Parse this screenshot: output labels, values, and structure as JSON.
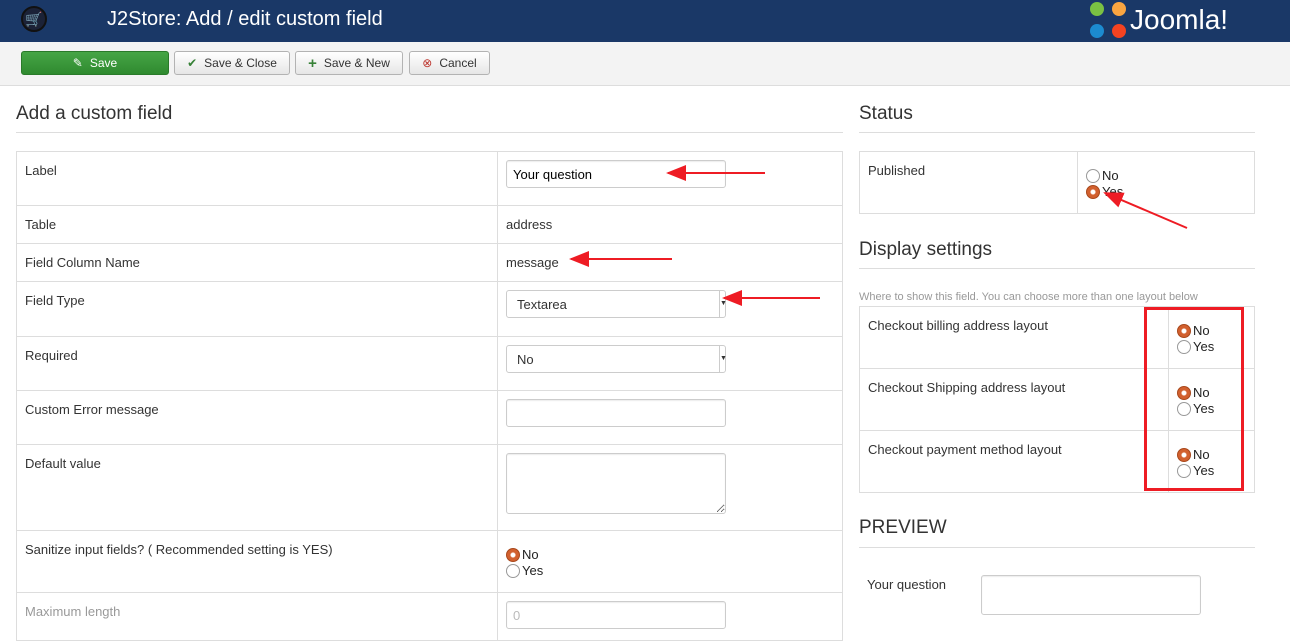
{
  "header": {
    "title": "J2Store: Add / edit custom field",
    "brand": "Joomla!"
  },
  "toolbar": {
    "save": "Save",
    "save_close": "Save & Close",
    "save_new": "Save & New",
    "cancel": "Cancel"
  },
  "main": {
    "heading": "Add a custom field",
    "rows": {
      "label": {
        "label": "Label",
        "value": "Your question"
      },
      "table": {
        "label": "Table",
        "value": "address"
      },
      "column": {
        "label": "Field Column Name",
        "value": "message"
      },
      "type": {
        "label": "Field Type",
        "value": "Textarea"
      },
      "required": {
        "label": "Required",
        "value": "No"
      },
      "error": {
        "label": "Custom Error message",
        "value": ""
      },
      "default": {
        "label": "Default value",
        "value": ""
      },
      "sanitize": {
        "label": "Sanitize input fields? ( Recommended setting is YES)",
        "no": "No",
        "yes": "Yes",
        "selected": "No"
      },
      "maxlen": {
        "label": "Maximum length",
        "value": "0"
      }
    }
  },
  "status": {
    "heading": "Status",
    "published_label": "Published",
    "no": "No",
    "yes": "Yes",
    "selected": "Yes"
  },
  "display": {
    "heading": "Display settings",
    "note": "Where to show this field. You can choose more than one layout below",
    "rows": [
      {
        "label": "Checkout billing address layout",
        "no": "No",
        "yes": "Yes",
        "selected": "No"
      },
      {
        "label": "Checkout Shipping address layout",
        "no": "No",
        "yes": "Yes",
        "selected": "No"
      },
      {
        "label": "Checkout payment method layout",
        "no": "No",
        "yes": "Yes",
        "selected": "No"
      }
    ]
  },
  "preview": {
    "heading": "PREVIEW",
    "field_label": "Your question"
  },
  "colors": {
    "header": "#1a3867",
    "accent_radio": "#d2602e",
    "annotation": "#ee1c24"
  }
}
